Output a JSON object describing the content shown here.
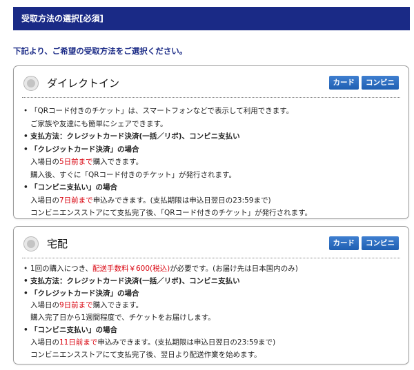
{
  "header": {
    "title": "受取方法の選択[必須]"
  },
  "intro": "下記より、ご希望の受取方法をご選択ください。",
  "badges": {
    "card": "カード",
    "conveni": "コンビニ"
  },
  "direct_in": {
    "title": "ダイレクトイン",
    "lines": {
      "l1": "「QRコード付きのチケット」は、スマートフォンなどで表示して利用できます。",
      "l2": "ご家族や友達にも簡単にシェアできます。",
      "l3": "支払方法：クレジットカード決済(一括／リボ)、コンビニ支払い",
      "l4": "「クレジットカード決済」の場合",
      "l5_a": "入場日の",
      "l5_red": "5日前まで",
      "l5_b": "購入できます。",
      "l6": "購入後、すぐに「QRコード付きのチケット」が発行されます。",
      "l7": "「コンビニ支払い」の場合",
      "l8_a": "入場日の",
      "l8_red": "7日前まで",
      "l8_b": "申込みできます。(支払期限は申込日翌日の23:59まで)",
      "l9": "コンビニエンスストアにて支払完了後、「QRコード付きのチケット」が発行されます。"
    }
  },
  "delivery": {
    "title": "宅配",
    "lines": {
      "l1_a": "1回の購入につき、",
      "l1_red": "配送手数料￥600(税込)",
      "l1_b": "が必要です。(お届け先は日本国内のみ)",
      "l2": "支払方法：クレジットカード決済(一括／リボ)、コンビニ支払い",
      "l3": "「クレジットカード決済」の場合",
      "l4_a": "入場日の",
      "l4_red": "9日前まで",
      "l4_b": "購入できます。",
      "l5": "購入完了日から1週間程度で、チケットをお届けします。",
      "l6": "「コンビニ支払い」の場合",
      "l7_a": "入場日の",
      "l7_red": "11日前まで",
      "l7_b": "申込みできます。(支払期限は申込日翌日の23:59まで)",
      "l8": "コンビニエンスストアにて支払完了後、翌日より配送作業を始めます。"
    }
  },
  "colors": {
    "header_bg": "#1a2a86",
    "badge": "#2a6cc0",
    "accent_red": "#d8000c"
  }
}
